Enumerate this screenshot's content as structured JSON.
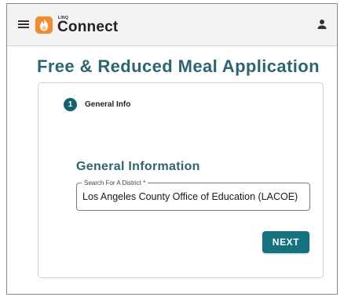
{
  "app": {
    "logo_small": "LINQ",
    "logo_name": "Connect",
    "menu_icon": "hamburger-menu-icon",
    "user_icon": "person-icon"
  },
  "page": {
    "title": "Free & Reduced Meal Application"
  },
  "stepper": {
    "steps": [
      {
        "number": "1",
        "label": "General Info"
      }
    ]
  },
  "form": {
    "section_title": "General Information",
    "district_label": "Search For A District *",
    "district_value": "Los Angeles County Office of Education (LACOE)",
    "next_label": "NEXT"
  },
  "colors": {
    "brand_orange": "#f28b2b",
    "primary_teal": "#16717f",
    "heading_teal": "#2d6470"
  }
}
